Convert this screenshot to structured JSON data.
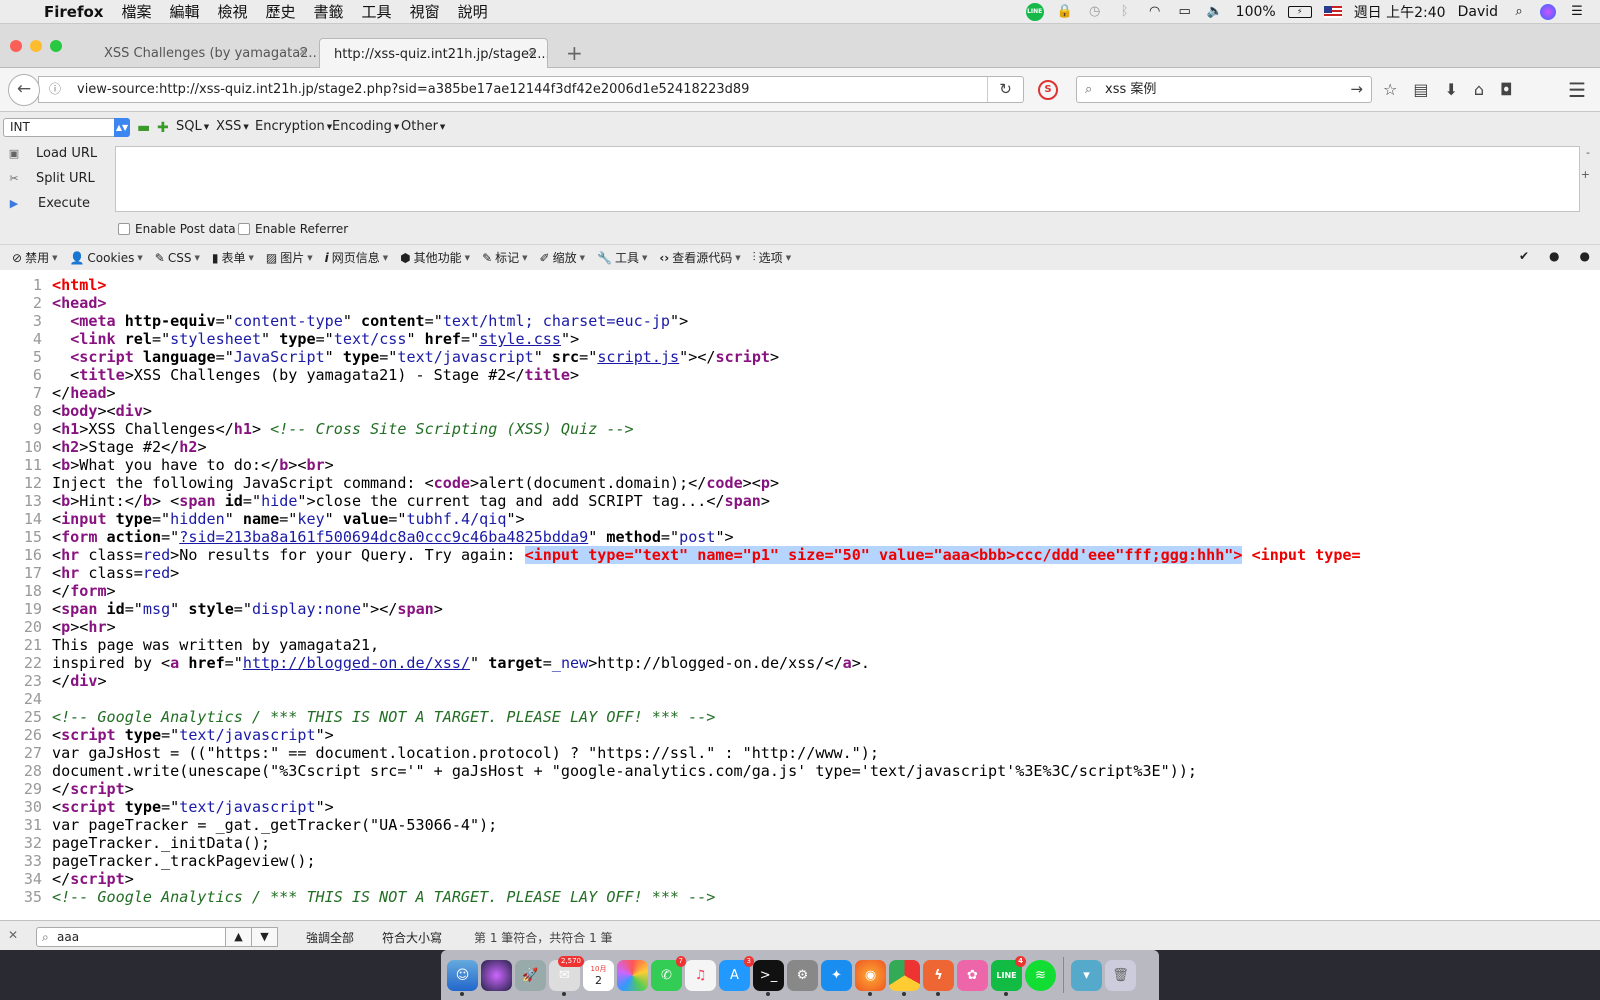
{
  "menubar": {
    "app": "Firefox",
    "items": [
      "檔案",
      "編輯",
      "檢視",
      "歷史",
      "書籤",
      "工具",
      "視窗",
      "說明"
    ],
    "battery": "100%",
    "clock": "週日 上午2:40",
    "user": "David"
  },
  "tabs": [
    {
      "title": "XSS Challenges (by yamagata2..."
    },
    {
      "title": "http://xss-quiz.int21h.jp/stage2..."
    }
  ],
  "navbar": {
    "url": "view-source:http://xss-quiz.int21h.jp/stage2.php?sid=a385be17ae12144f3df42e2006d1e52418223d89",
    "search_value": "xss 案例"
  },
  "hackbar": {
    "select_value": "INT",
    "menus": [
      "SQL",
      "XSS",
      "Encryption",
      "Encoding",
      "Other"
    ],
    "actions": [
      "Load URL",
      "Split URL",
      "Execute"
    ],
    "checkboxes": [
      "Enable Post data",
      "Enable Referrer"
    ],
    "textarea_value": ""
  },
  "webdev": {
    "items": [
      {
        "label": "禁用",
        "icon": "disable-icon"
      },
      {
        "label": "Cookies",
        "icon": "person-icon"
      },
      {
        "label": "CSS",
        "icon": "wand-icon"
      },
      {
        "label": "表单",
        "icon": "clipboard-icon"
      },
      {
        "label": "图片",
        "icon": "image-icon"
      },
      {
        "label": "网页信息",
        "icon": "info-icon"
      },
      {
        "label": "其他功能",
        "icon": "cube-icon"
      },
      {
        "label": "标记",
        "icon": "pencil-icon"
      },
      {
        "label": "缩放",
        "icon": "resize-icon"
      },
      {
        "label": "工具",
        "icon": "wrench-icon"
      },
      {
        "label": "查看源代码",
        "icon": "code-icon"
      },
      {
        "label": "选项",
        "icon": "sliders-icon"
      }
    ]
  },
  "source_lines": [
    [
      [
        "r",
        "<html>"
      ]
    ],
    [
      [
        "t",
        "<head>"
      ]
    ],
    [
      [
        "p",
        "  "
      ],
      [
        "t",
        "<meta"
      ],
      [
        "a",
        " http-equiv"
      ],
      [
        "p",
        "=\""
      ],
      [
        "v",
        "content-type"
      ],
      [
        "p",
        "\""
      ],
      [
        "a",
        " content"
      ],
      [
        "p",
        "=\""
      ],
      [
        "v",
        "text/html; charset=euc-jp"
      ],
      [
        "p",
        "\">"
      ]
    ],
    [
      [
        "p",
        "  "
      ],
      [
        "t",
        "<link"
      ],
      [
        "a",
        " rel"
      ],
      [
        "p",
        "=\""
      ],
      [
        "v",
        "stylesheet"
      ],
      [
        "p",
        "\""
      ],
      [
        "a",
        " type"
      ],
      [
        "p",
        "=\""
      ],
      [
        "v",
        "text/css"
      ],
      [
        "p",
        "\""
      ],
      [
        "a",
        " href"
      ],
      [
        "p",
        "=\""
      ],
      [
        "k",
        "style.css"
      ],
      [
        "p",
        "\">"
      ]
    ],
    [
      [
        "p",
        "  "
      ],
      [
        "t",
        "<script"
      ],
      [
        "a",
        " language"
      ],
      [
        "p",
        "=\""
      ],
      [
        "v",
        "JavaScript"
      ],
      [
        "p",
        "\""
      ],
      [
        "a",
        " type"
      ],
      [
        "p",
        "=\""
      ],
      [
        "v",
        "text/javascript"
      ],
      [
        "p",
        "\""
      ],
      [
        "a",
        " src"
      ],
      [
        "p",
        "=\""
      ],
      [
        "k",
        "script.js"
      ],
      [
        "p",
        "\"></"
      ],
      [
        "t",
        "script"
      ],
      [
        "p",
        ">"
      ]
    ],
    [
      [
        "p",
        "  <"
      ],
      [
        "t",
        "title"
      ],
      [
        "p",
        ">XSS Challenges (by yamagata21) - Stage #2</"
      ],
      [
        "t",
        "title"
      ],
      [
        "p",
        ">"
      ]
    ],
    [
      [
        "p",
        "</"
      ],
      [
        "t",
        "head"
      ],
      [
        "p",
        ">"
      ]
    ],
    [
      [
        "p",
        "<"
      ],
      [
        "t",
        "body"
      ],
      [
        "p",
        "><"
      ],
      [
        "t",
        "div"
      ],
      [
        "p",
        ">"
      ]
    ],
    [
      [
        "p",
        "<"
      ],
      [
        "t",
        "h1"
      ],
      [
        "p",
        ">XSS Challenges</"
      ],
      [
        "t",
        "h1"
      ],
      [
        "p",
        "> "
      ],
      [
        "c",
        "<!-- Cross Site Scripting (XSS) Quiz -->"
      ]
    ],
    [
      [
        "p",
        "<"
      ],
      [
        "t",
        "h2"
      ],
      [
        "p",
        ">Stage #2</"
      ],
      [
        "t",
        "h2"
      ],
      [
        "p",
        ">"
      ]
    ],
    [
      [
        "p",
        "<"
      ],
      [
        "t",
        "b"
      ],
      [
        "p",
        ">What you have to do:</"
      ],
      [
        "t",
        "b"
      ],
      [
        "p",
        "><"
      ],
      [
        "t",
        "br"
      ],
      [
        "p",
        ">"
      ]
    ],
    [
      [
        "p",
        "Inject the following JavaScript command: <"
      ],
      [
        "t",
        "code"
      ],
      [
        "p",
        ">alert(document.domain);</"
      ],
      [
        "t",
        "code"
      ],
      [
        "p",
        "><"
      ],
      [
        "t",
        "p"
      ],
      [
        "p",
        ">"
      ]
    ],
    [
      [
        "p",
        "<"
      ],
      [
        "t",
        "b"
      ],
      [
        "p",
        ">Hint:</"
      ],
      [
        "t",
        "b"
      ],
      [
        "p",
        "> <"
      ],
      [
        "t",
        "span"
      ],
      [
        "a",
        " id"
      ],
      [
        "p",
        "=\""
      ],
      [
        "v",
        "hide"
      ],
      [
        "p",
        "\">close the current tag and add SCRIPT tag...</"
      ],
      [
        "t",
        "span"
      ],
      [
        "p",
        ">"
      ]
    ],
    [
      [
        "p",
        "<"
      ],
      [
        "t",
        "input"
      ],
      [
        "a",
        " type"
      ],
      [
        "p",
        "=\""
      ],
      [
        "v",
        "hidden"
      ],
      [
        "p",
        "\""
      ],
      [
        "a",
        " name"
      ],
      [
        "p",
        "=\""
      ],
      [
        "v",
        "key"
      ],
      [
        "p",
        "\""
      ],
      [
        "a",
        " value"
      ],
      [
        "p",
        "=\""
      ],
      [
        "v",
        "tubhf.4/qiq"
      ],
      [
        "p",
        "\">"
      ]
    ],
    [
      [
        "p",
        "<"
      ],
      [
        "t",
        "form"
      ],
      [
        "a",
        " action"
      ],
      [
        "p",
        "=\""
      ],
      [
        "k",
        "?sid=213ba8a161f500694dc8a0ccc9c46ba4825bdda9"
      ],
      [
        "p",
        "\""
      ],
      [
        "a",
        " method"
      ],
      [
        "p",
        "=\""
      ],
      [
        "v",
        "post"
      ],
      [
        "p",
        "\">"
      ]
    ],
    [
      [
        "p",
        "<"
      ],
      [
        "t",
        "hr"
      ],
      [
        "p",
        " class="
      ],
      [
        "v",
        "red"
      ],
      [
        "p",
        ">No results for your Query. Try again: "
      ],
      [
        "s",
        "<input type=\"text\" name=\"p1\" size=\"50\" value=\"aaa<bbb>ccc/ddd'eee\"fff;ggg:hhh\">"
      ],
      [
        "p",
        " "
      ],
      [
        "r",
        "<input type="
      ]
    ],
    [
      [
        "p",
        "<"
      ],
      [
        "t",
        "hr"
      ],
      [
        "p",
        " class="
      ],
      [
        "v",
        "red"
      ],
      [
        "p",
        ">"
      ]
    ],
    [
      [
        "p",
        "</"
      ],
      [
        "t",
        "form"
      ],
      [
        "p",
        ">"
      ]
    ],
    [
      [
        "p",
        "<"
      ],
      [
        "t",
        "span"
      ],
      [
        "a",
        " id"
      ],
      [
        "p",
        "=\""
      ],
      [
        "v",
        "msg"
      ],
      [
        "p",
        "\""
      ],
      [
        "a",
        " style"
      ],
      [
        "p",
        "=\""
      ],
      [
        "v",
        "display:none"
      ],
      [
        "p",
        "\"></"
      ],
      [
        "t",
        "span"
      ],
      [
        "p",
        ">"
      ]
    ],
    [
      [
        "p",
        "<"
      ],
      [
        "t",
        "p"
      ],
      [
        "p",
        "><"
      ],
      [
        "t",
        "hr"
      ],
      [
        "p",
        ">"
      ]
    ],
    [
      [
        "p",
        "This page was written by yamagata21,"
      ]
    ],
    [
      [
        "p",
        "inspired by <"
      ],
      [
        "t",
        "a"
      ],
      [
        "a",
        " href"
      ],
      [
        "p",
        "=\""
      ],
      [
        "k",
        "http://blogged-on.de/xss/"
      ],
      [
        "p",
        "\""
      ],
      [
        "a",
        " target"
      ],
      [
        "p",
        "="
      ],
      [
        "v",
        "_new"
      ],
      [
        "p",
        ">http://blogged-on.de/xss/</"
      ],
      [
        "t",
        "a"
      ],
      [
        "p",
        ">."
      ]
    ],
    [
      [
        "p",
        "</"
      ],
      [
        "t",
        "div"
      ],
      [
        "p",
        ">"
      ]
    ],
    [],
    [
      [
        "c",
        "<!-- Google Analytics / *** THIS IS NOT A TARGET. PLEASE LAY OFF! *** -->"
      ]
    ],
    [
      [
        "p",
        "<"
      ],
      [
        "t",
        "script"
      ],
      [
        "a",
        " type"
      ],
      [
        "p",
        "=\""
      ],
      [
        "v",
        "text/javascript"
      ],
      [
        "p",
        "\">"
      ]
    ],
    [
      [
        "p",
        "var gaJsHost = ((\"https:\" == document.location.protocol) ? \"https://ssl.\" : \"http://www.\");"
      ]
    ],
    [
      [
        "p",
        "document.write(unescape(\"%3Cscript src='\" + gaJsHost + \"google-analytics.com/ga.js' type='text/javascript'%3E%3C/script%3E\"));"
      ]
    ],
    [
      [
        "p",
        "</"
      ],
      [
        "t",
        "script"
      ],
      [
        "p",
        ">"
      ]
    ],
    [
      [
        "p",
        "<"
      ],
      [
        "t",
        "script"
      ],
      [
        "a",
        " type"
      ],
      [
        "p",
        "=\""
      ],
      [
        "v",
        "text/javascript"
      ],
      [
        "p",
        "\">"
      ]
    ],
    [
      [
        "p",
        "var pageTracker = _gat._getTracker(\"UA-53066-4\");"
      ]
    ],
    [
      [
        "p",
        "pageTracker._initData();"
      ]
    ],
    [
      [
        "p",
        "pageTracker._trackPageview();"
      ]
    ],
    [
      [
        "p",
        "</"
      ],
      [
        "t",
        "script"
      ],
      [
        "p",
        ">"
      ]
    ],
    [
      [
        "c",
        "<!-- Google Analytics / *** THIS IS NOT A TARGET. PLEASE LAY OFF! *** -->"
      ]
    ]
  ],
  "findbar": {
    "query": "aaa",
    "highlight_all": "強調全部",
    "match_case": "符合大小寫",
    "status": "第 1 筆符合，共符合 1 筆"
  },
  "dock": {
    "badges": {
      "calendar_month": "10月",
      "calendar_day": "2",
      "mail": "2,570",
      "messages": "7",
      "appstore": "3",
      "line": "4"
    }
  }
}
